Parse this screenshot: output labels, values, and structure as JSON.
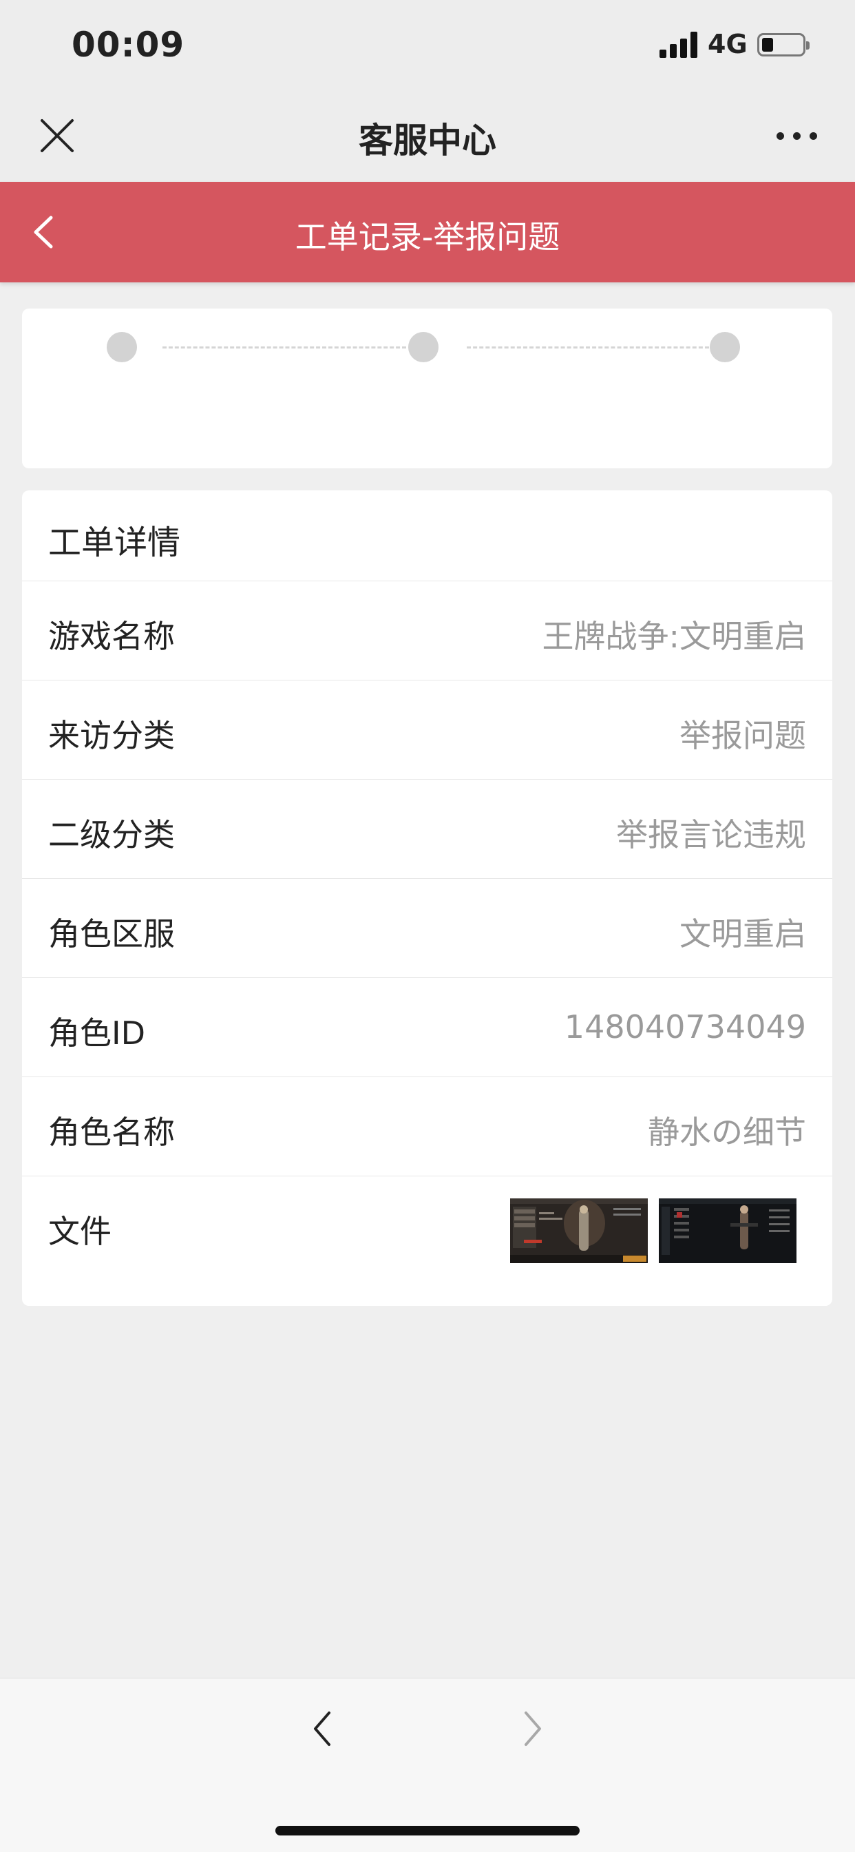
{
  "status_bar": {
    "time": "00:09",
    "network": "4G",
    "signal_icon": "signal-bars-icon",
    "battery_icon": "battery-low-icon"
  },
  "nav": {
    "title": "客服中心",
    "close_icon": "close-icon",
    "more_icon": "more-icon"
  },
  "header": {
    "title": "工单记录-举报问题",
    "back_icon": "chevron-left-icon",
    "color": "#d5565f"
  },
  "progress": {
    "steps": 3
  },
  "details": {
    "title": "工单详情",
    "rows": [
      {
        "label": "游戏名称",
        "value": "王牌战争:文明重启"
      },
      {
        "label": "来访分类",
        "value": "举报问题"
      },
      {
        "label": "二级分类",
        "value": "举报言论违规"
      },
      {
        "label": "角色区服",
        "value": "文明重启"
      },
      {
        "label": "角色ID",
        "value": "148040734049"
      },
      {
        "label": "角色名称",
        "value": "静水の细节"
      }
    ],
    "files": {
      "label": "文件",
      "thumbnails": [
        "screenshot-thumbnail-1",
        "screenshot-thumbnail-2"
      ]
    }
  },
  "bottom_bar": {
    "back_icon": "chevron-left-icon",
    "forward_icon": "chevron-right-icon"
  }
}
